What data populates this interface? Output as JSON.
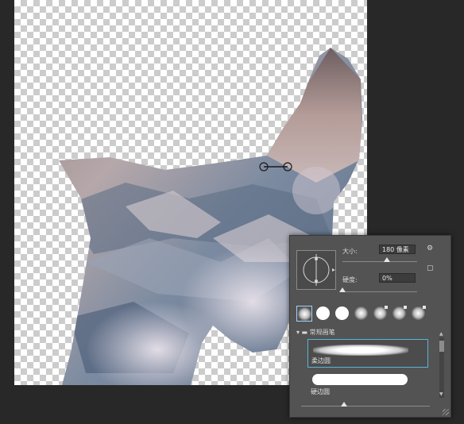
{
  "canvas": {
    "description_free": true
  },
  "brush_panel": {
    "size_label": "大小:",
    "size_value": "180 像素",
    "hardness_label": "硬度:",
    "hardness_value": "0%",
    "size_level": 0.6,
    "hardness_level": 0.0,
    "presets": [
      "soft-round",
      "hard-round",
      "hard-round",
      "soft-round",
      "soft-round",
      "soft-round",
      "soft-round"
    ],
    "group_label": "常规画笔",
    "brushes": [
      {
        "name": "柔边圆",
        "kind": "soft",
        "selected": true
      },
      {
        "name": "硬边圆",
        "kind": "hard",
        "selected": false
      }
    ],
    "colors": {
      "panel": "#535353",
      "selection": "#5ab4d6",
      "field": "#3c3c3c"
    }
  }
}
